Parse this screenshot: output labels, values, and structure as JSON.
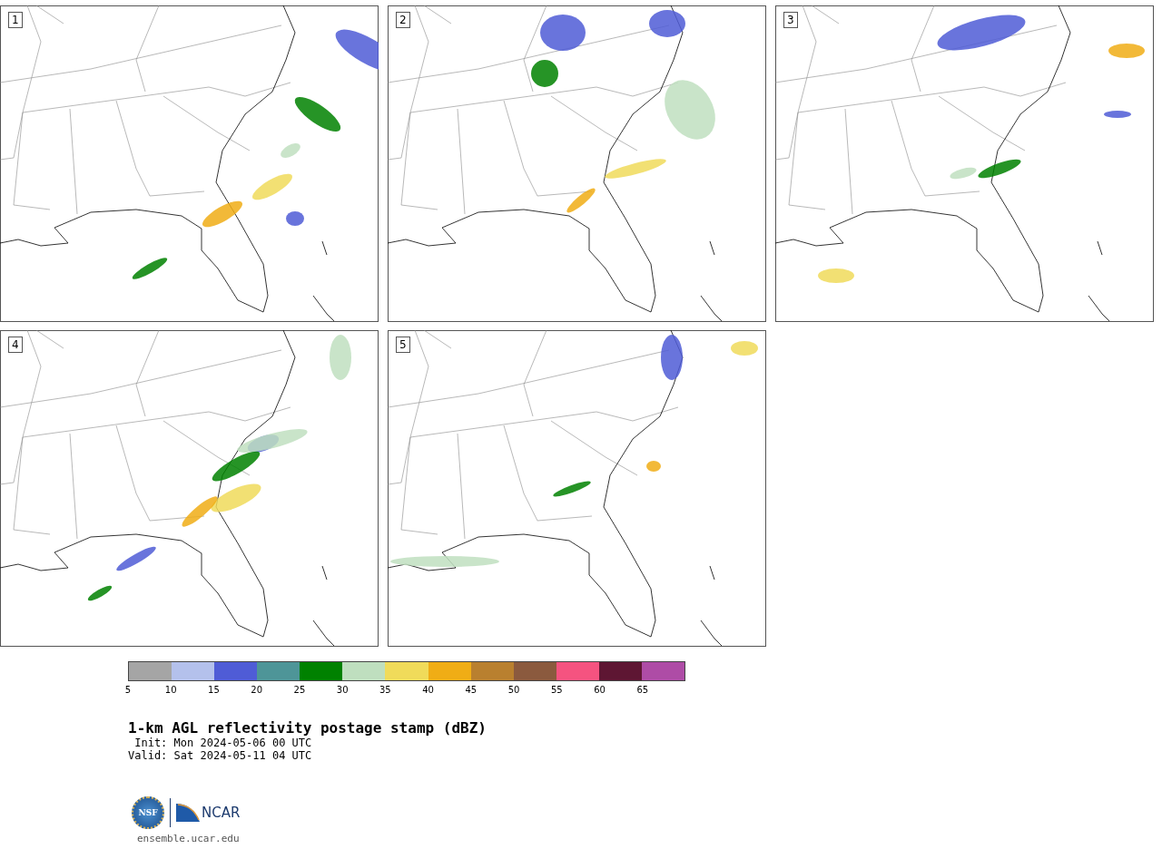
{
  "panels": [
    {
      "label": "1"
    },
    {
      "label": "2"
    },
    {
      "label": "3"
    },
    {
      "label": "4"
    },
    {
      "label": "5"
    }
  ],
  "colorbar": {
    "bins": [
      {
        "label": "5",
        "color": "#a5a5a5"
      },
      {
        "label": "10",
        "color": "#b4c1ec"
      },
      {
        "label": "15",
        "color": "#4f5cd6"
      },
      {
        "label": "20",
        "color": "#4e9598"
      },
      {
        "label": "25",
        "color": "#008100"
      },
      {
        "label": "30",
        "color": "#bfdfbf"
      },
      {
        "label": "35",
        "color": "#f0db5a"
      },
      {
        "label": "40",
        "color": "#f0ad15"
      },
      {
        "label": "45",
        "color": "#b9802f"
      },
      {
        "label": "50",
        "color": "#8b5a3e"
      },
      {
        "label": "55",
        "color": "#f55380"
      },
      {
        "label": "60",
        "color": "#5e1633"
      },
      {
        "label": "65",
        "color": "#ae4ca6"
      }
    ]
  },
  "title": "1-km AGL reflectivity postage stamp (dBZ)",
  "init": "Init: Mon 2024-05-06 00 UTC",
  "valid": "Valid: Sat 2024-05-11 04 UTC",
  "logo": {
    "nsf": "NSF",
    "ncar": "NCAR"
  },
  "footer": "ensemble.ucar.edu"
}
